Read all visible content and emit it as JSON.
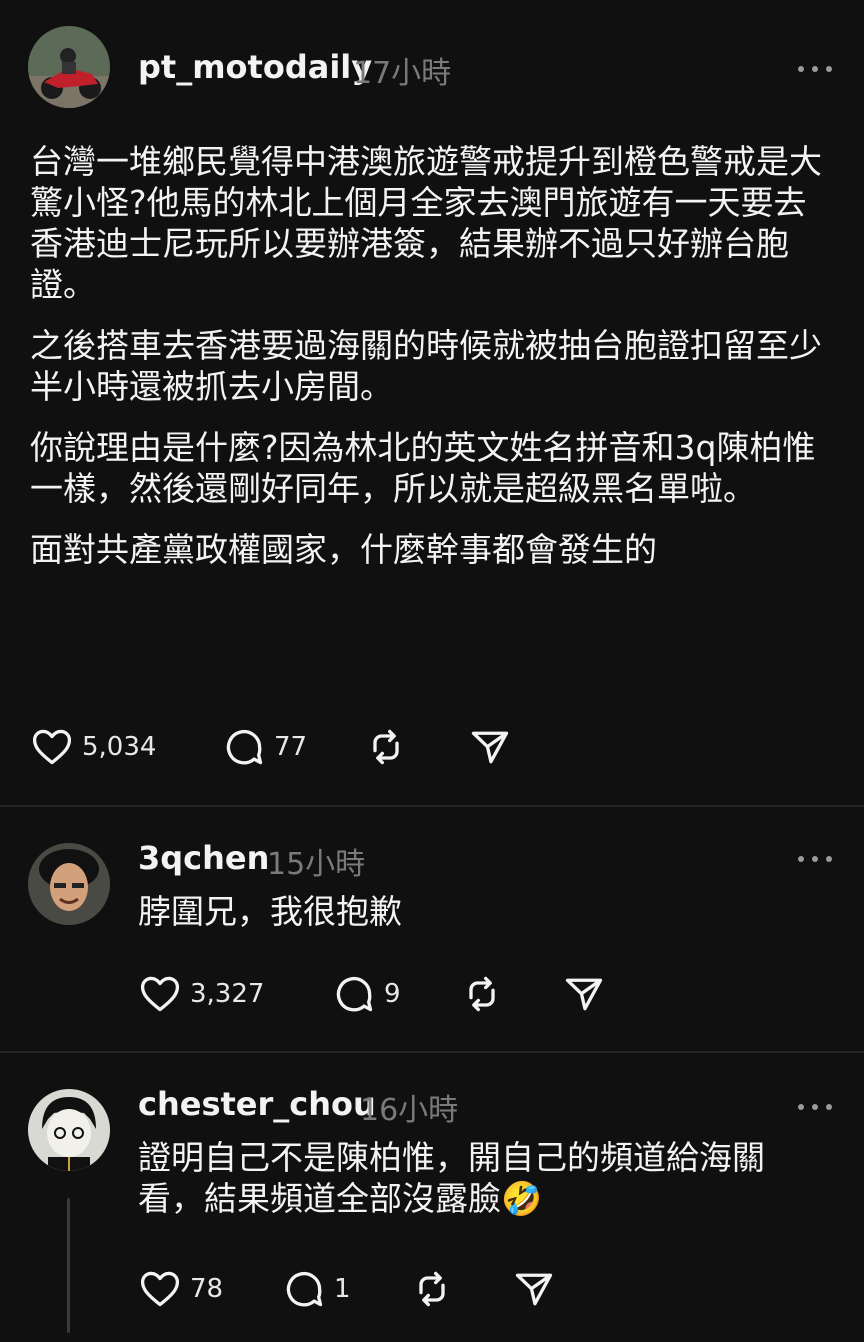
{
  "posts": [
    {
      "username": "pt_motodaily",
      "time": "17小時",
      "paragraphs": [
        "台灣一堆鄉民覺得中港澳旅遊警戒提升到橙色警戒是大驚小怪?他馬的林北上個月全家去澳門旅遊有一天要去香港迪士尼玩所以要辦港簽，結果辦不過只好辦台胞證。",
        "之後搭車去香港要過海關的時候就被抽台胞證扣留至少半小時還被抓去小房間。",
        "你說理由是什麼?因為林北的英文姓名拼音和3q陳柏惟一樣，然後還剛好同年，所以就是超級黑名單啦。",
        "面對共產黨政權國家，什麼幹事都會發生的"
      ],
      "likes": "5,034",
      "replies": "77"
    },
    {
      "username": "3qchen",
      "time": "15小時",
      "paragraphs": [
        "脖圍兄，我很抱歉"
      ],
      "likes": "3,327",
      "replies": "9"
    },
    {
      "username": "chester_chou",
      "time": "16小時",
      "paragraphs": [
        "證明自己不是陳柏惟，開自己的頻道給海關看，結果頻道全部沒露臉🤣"
      ],
      "likes": "78",
      "replies": "1"
    }
  ]
}
